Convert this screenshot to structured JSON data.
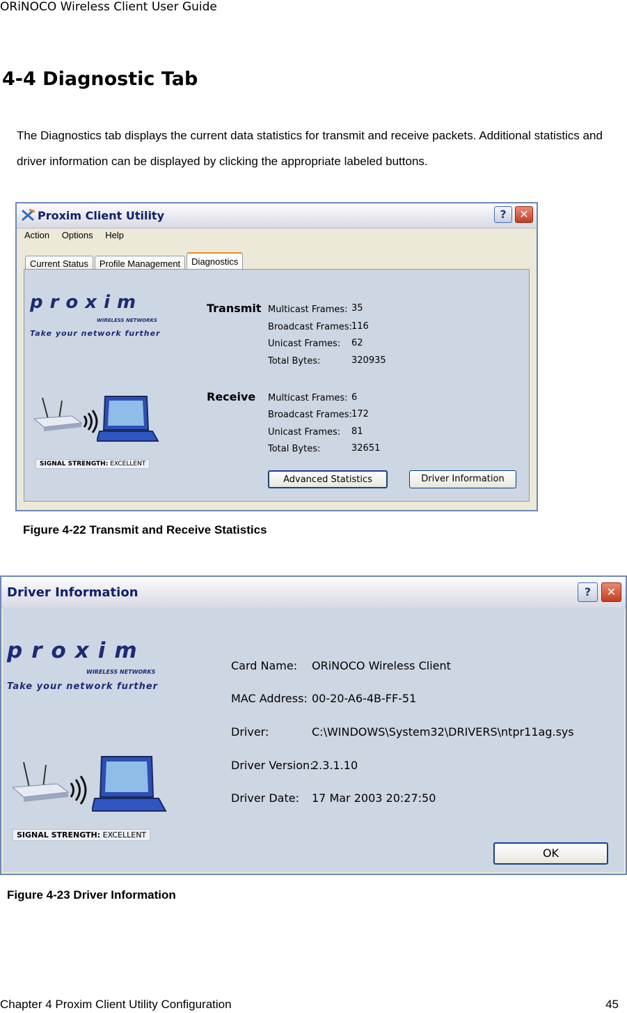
{
  "doc": {
    "header": "ORiNOCO Wireless Client User Guide",
    "section_title": "4-4 Diagnostic Tab",
    "paragraph": "The Diagnostics tab displays the current data statistics for transmit and receive packets. Additional statistics and driver information can be displayed by clicking the appropriate labeled buttons.",
    "caption1": "Figure 4-22  Transmit and Receive Statistics",
    "caption2": "Figure 4-23 Driver Information",
    "footer_left": "Chapter 4 Proxim Client Utility Configuration",
    "page_number": "45"
  },
  "utility": {
    "title": "Proxim Client Utility",
    "help_btn": "?",
    "close_btn": "✕",
    "menu": [
      "Action",
      "Options",
      "Help"
    ],
    "tabs": [
      "Current Status",
      "Profile Management",
      "Diagnostics"
    ],
    "active_tab": "Diagnostics",
    "transmit": {
      "heading": "Transmit",
      "rows": [
        {
          "label": "Multicast Frames:",
          "value": "35"
        },
        {
          "label": "Broadcast Frames:",
          "value": "116"
        },
        {
          "label": "Unicast Frames:",
          "value": "62"
        },
        {
          "label": "Total Bytes:",
          "value": "320935"
        }
      ]
    },
    "receive": {
      "heading": "Receive",
      "rows": [
        {
          "label": "Multicast Frames:",
          "value": "6"
        },
        {
          "label": "Broadcast Frames:",
          "value": "172"
        },
        {
          "label": "Unicast Frames:",
          "value": "81"
        },
        {
          "label": "Total Bytes:",
          "value": "32651"
        }
      ]
    },
    "advanced_btn": "Advanced Statistics",
    "driver_btn": "Driver Information"
  },
  "brand": {
    "logo": "proxim",
    "sub": "WIRELESS NETWORKS",
    "tagline": "Take your network further",
    "signal_label": "SIGNAL STRENGTH:",
    "signal_value": "EXCELLENT"
  },
  "driver_info": {
    "title": "Driver Information",
    "help_btn": "?",
    "close_btn": "✕",
    "fields": [
      {
        "label": "Card Name:",
        "value": "ORiNOCO Wireless Client"
      },
      {
        "label": "MAC Address:",
        "value": "00-20-A6-4B-FF-51"
      },
      {
        "label": "Driver:",
        "value": "C:\\WINDOWS\\System32\\DRIVERS\\ntpr11ag.sys"
      },
      {
        "label": "Driver Version:",
        "value": "2.3.1.10"
      },
      {
        "label": "Driver Date:",
        "value": "17 Mar 2003 20:27:50"
      }
    ],
    "ok_btn": "OK"
  },
  "colors": {
    "titlebar_text": "#10206a",
    "panel_bg": "#cdd6e3",
    "brand_blue": "#1d2a76",
    "window_bg": "#ece9d8"
  }
}
